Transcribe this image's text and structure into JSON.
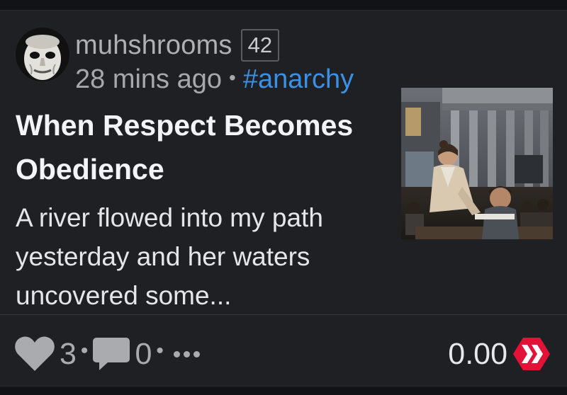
{
  "post": {
    "author": "muhshrooms",
    "reputation": "42",
    "timestamp": "28 mins ago",
    "separator": "•",
    "tag": "#anarchy",
    "title": "When Respect Becomes Obedience",
    "excerpt": "A river flowed into my path yesterday and her waters uncovered some...",
    "thumbnail_alt": "Teacher leaning over a desk in a classroom with students"
  },
  "actions": {
    "votes": "3",
    "comments": "0",
    "dot": "•",
    "payout": "0.00"
  },
  "icons": {
    "avatar": "masked-face-avatar",
    "upvote": "heart-icon",
    "comments": "comment-bubble-icon",
    "more": "more-dots-icon",
    "currency": "hive-logo-icon"
  },
  "colors": {
    "background": "#1f2023",
    "tag": "#3a90e5",
    "hive": "#e31337",
    "muted": "#a9abaf"
  }
}
